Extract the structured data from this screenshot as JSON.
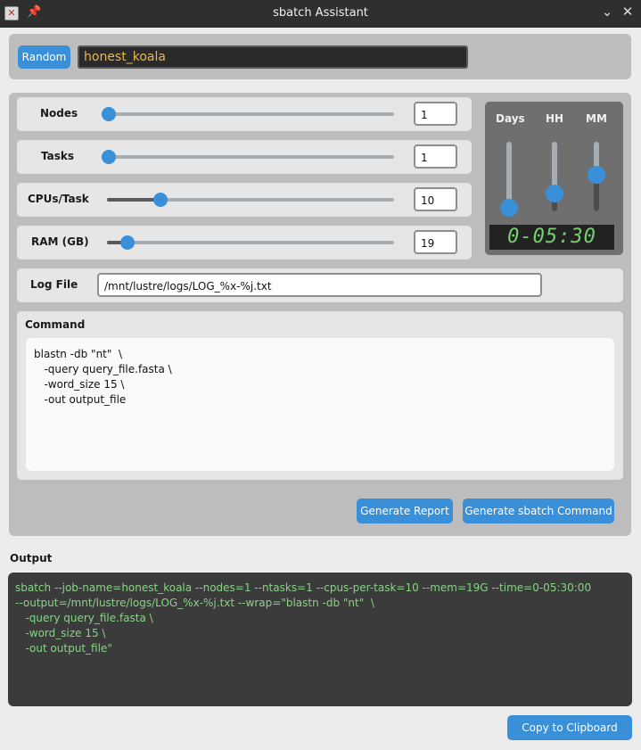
{
  "window": {
    "title": "sbatch Assistant",
    "app_icon": "x-app-icon",
    "pin_icon": "pin-icon",
    "minimize_icon": "chevron-down-icon",
    "close_icon": "close-icon"
  },
  "job": {
    "random_label": "Random",
    "job_name": "honest_koala"
  },
  "resources": {
    "nodes": {
      "label": "Nodes",
      "value": "1",
      "slider_fraction": 0.0
    },
    "tasks": {
      "label": "Tasks",
      "value": "1",
      "slider_fraction": 0.0
    },
    "cpus": {
      "label": "CPUs/Task",
      "value": "10",
      "slider_fraction": 0.19
    },
    "ram": {
      "label": "RAM (GB)",
      "value": "19",
      "slider_fraction": 0.07
    }
  },
  "time": {
    "days_label": "Days",
    "hh_label": "HH",
    "mm_label": "MM",
    "days_fraction": 0.0,
    "hh_fraction": 0.25,
    "mm_fraction": 0.6,
    "display": "0-05:30"
  },
  "log": {
    "label": "Log File",
    "path": "/mnt/lustre/logs/LOG_%x-%j.txt"
  },
  "command": {
    "label": "Command",
    "text": "blastn -db \"nt\"  \\\n   -query query_file.fasta \\\n   -word_size 15 \\\n   -out output_file"
  },
  "actions": {
    "generate_report": "Generate Report",
    "generate_sbatch": "Generate sbatch Command",
    "copy": "Copy to Clipboard"
  },
  "output": {
    "label": "Output",
    "text": "sbatch --job-name=honest_koala --nodes=1 --ntasks=1 --cpus-per-task=10 --mem=19G --time=0-05:30:00\n--output=/mnt/lustre/logs/LOG_%x-%j.txt --wrap=\"blastn -db \"nt\"  \\\n   -query query_file.fasta \\\n   -word_size 15 \\\n   -out output_file\""
  },
  "colors": {
    "accent": "#3a8fd9",
    "lcd_text": "#74d16c",
    "output_text": "#86d483",
    "job_name_text": "#e8b84a"
  }
}
